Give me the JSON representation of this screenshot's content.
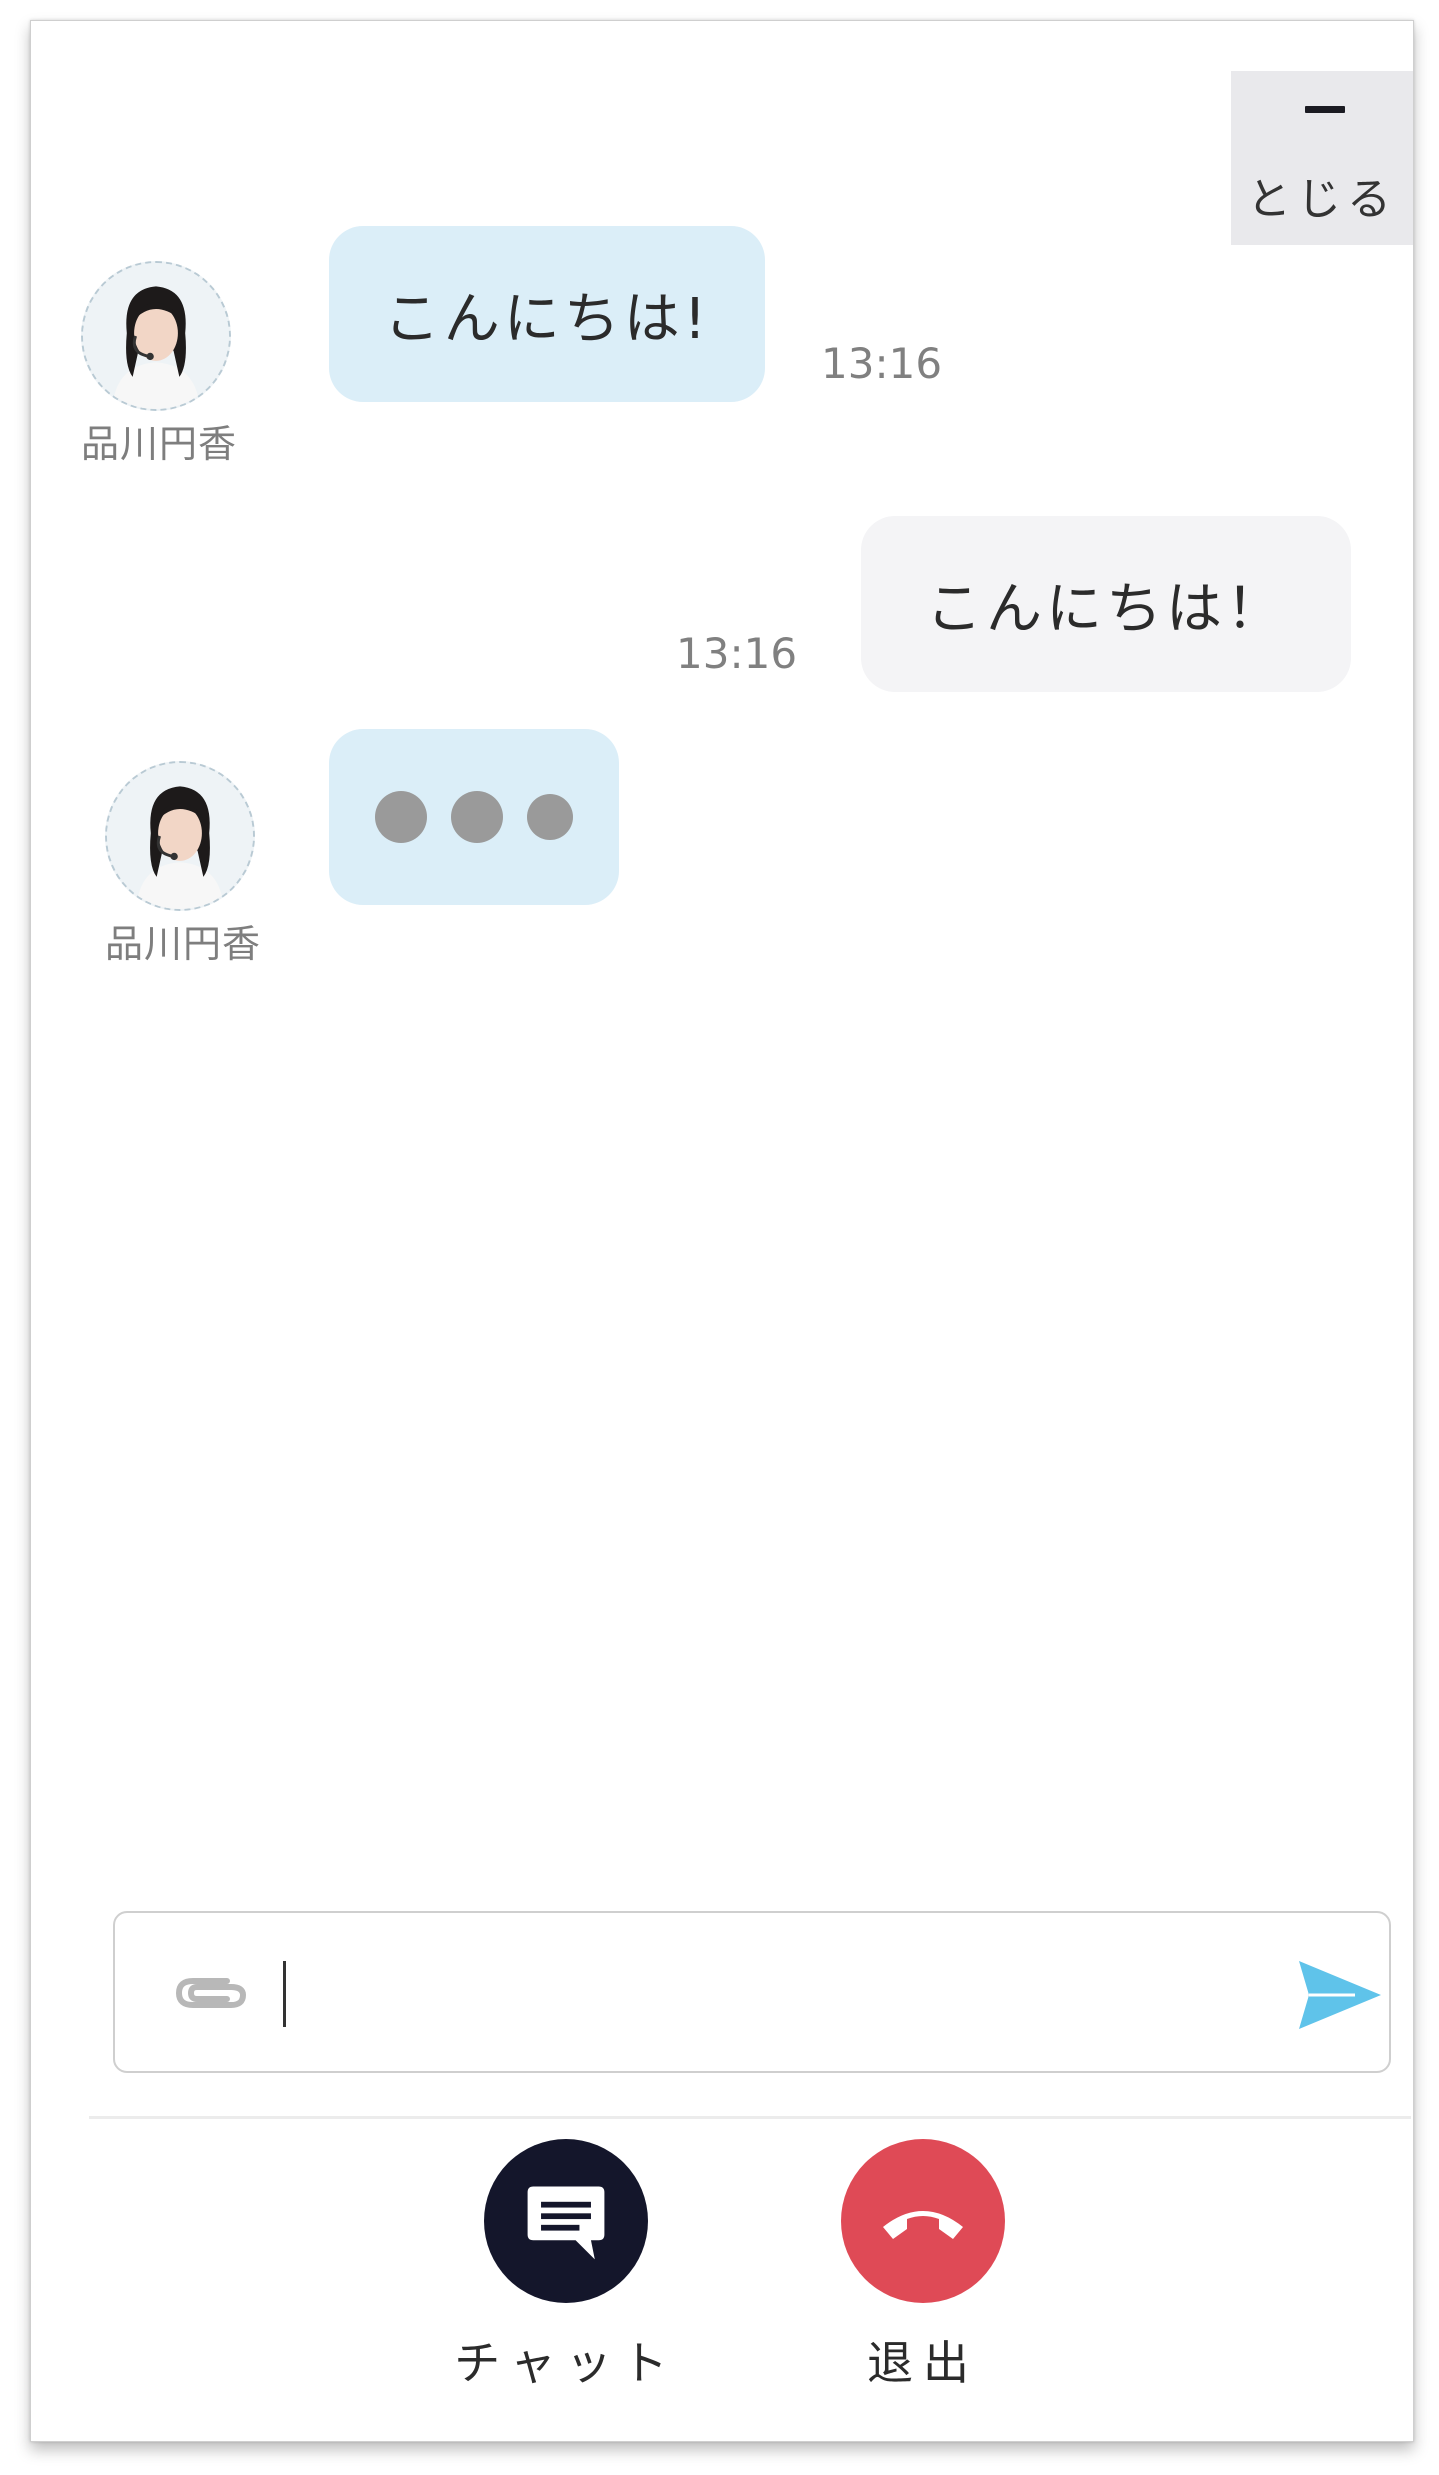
{
  "header": {
    "close_label": "とじる"
  },
  "messages": [
    {
      "sender": "agent",
      "name": "品川円香",
      "text": "こんにちは!",
      "time": "13:16"
    },
    {
      "sender": "user",
      "text": "こんにちは！",
      "time": "13:16"
    },
    {
      "sender": "agent",
      "name": "品川円香",
      "typing": true
    }
  ],
  "composer": {
    "value": "",
    "placeholder": ""
  },
  "actions": {
    "chat_label": "チャット",
    "leave_label": "退出"
  },
  "colors": {
    "agent_bubble": "#dbeef8",
    "user_bubble": "#f4f4f6",
    "send_icon": "#5fc3ea",
    "chat_button": "#14162b",
    "leave_button": "#df4a56"
  },
  "icons": {
    "close": "minus-icon",
    "attach": "paperclip-icon",
    "send": "send-icon",
    "chat": "chat-bubble-icon",
    "leave": "phone-hangup-icon"
  }
}
